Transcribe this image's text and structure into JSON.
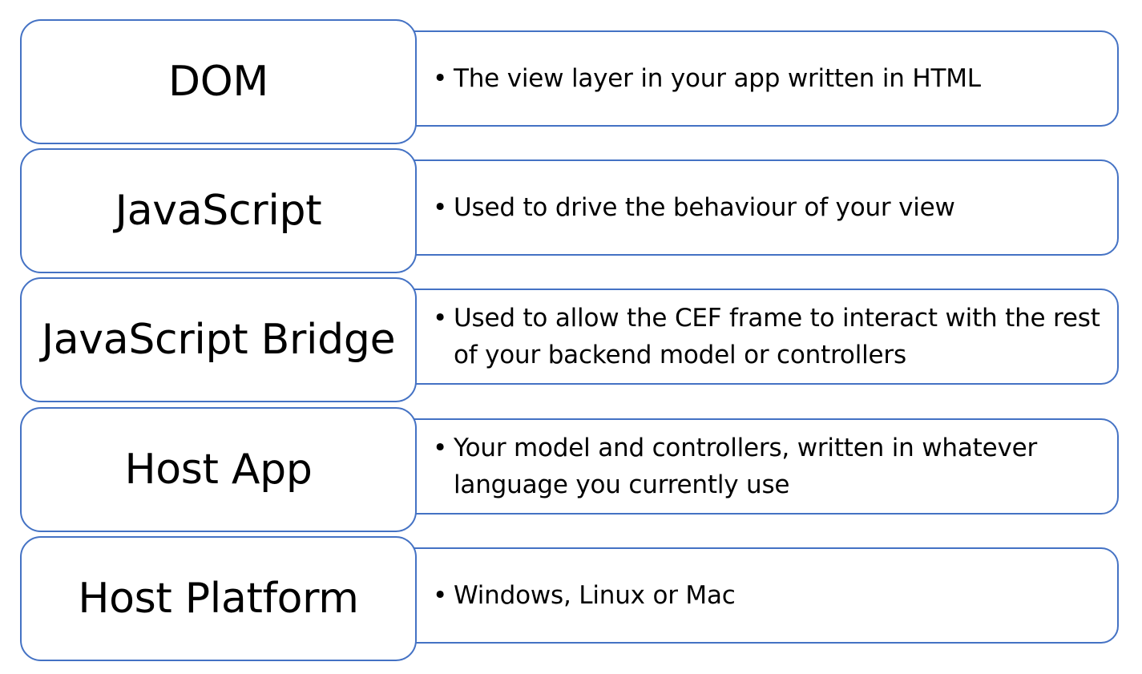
{
  "colors": {
    "border": "#4472c4",
    "fill": "#ffffff",
    "text": "#000000"
  },
  "layers": [
    {
      "title": "DOM",
      "bullet": "•",
      "description": "The view layer in your app written in HTML"
    },
    {
      "title": "JavaScript",
      "bullet": "•",
      "description": "Used to drive the behaviour of your view"
    },
    {
      "title": "JavaScript Bridge",
      "bullet": "•",
      "description": "Used to allow the CEF frame to interact with the rest of your backend model or controllers"
    },
    {
      "title": "Host App",
      "bullet": "•",
      "description": "Your model and controllers, written in whatever language you currently use"
    },
    {
      "title": "Host Platform",
      "bullet": "•",
      "description": "Windows, Linux or Mac"
    }
  ]
}
